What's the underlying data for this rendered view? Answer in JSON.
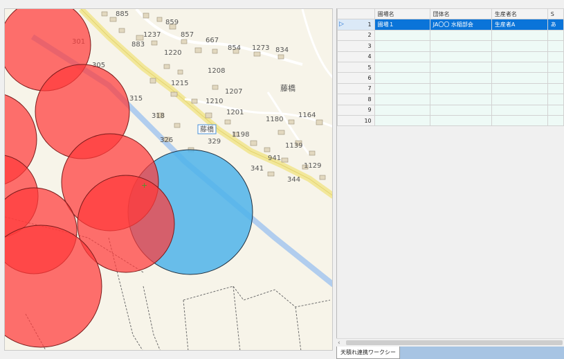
{
  "map": {
    "labels": {
      "n885": "885",
      "n859": "859",
      "n1237": "1237",
      "n857": "857",
      "n301": "301",
      "n883": "883",
      "n667": "667",
      "n854": "854",
      "n1273": "1273",
      "n834": "834",
      "n1220": "1220",
      "n305": "305",
      "n1208": "1208",
      "n1215": "1215",
      "n1207": "1207",
      "n315": "315",
      "n1210": "1210",
      "n1201": "1201",
      "n318": "318",
      "n1180": "1180",
      "n1164": "1164",
      "n1198": "1198",
      "n326": "326",
      "n329": "329",
      "n1139": "1139",
      "n941": "941",
      "n341": "341",
      "n1129": "1129",
      "n344": "344"
    },
    "place_name": "藤橋",
    "station_label": "藤橋",
    "colors": {
      "red_circle": "#ff3a3a",
      "blue_circle": "#4fb3ea",
      "road": "#f2e79a",
      "rail": "#a9c9ee",
      "background": "#f7f4e9"
    }
  },
  "grid": {
    "columns": [
      "",
      "圃場名",
      "団体名",
      "生産者名",
      "S"
    ],
    "rows": [
      {
        "num": "1",
        "field": "圃場１",
        "group": "JA〇〇 水稲部会",
        "producer": "生産者A",
        "extra": "あ"
      },
      {
        "num": "2",
        "field": "",
        "group": "",
        "producer": "",
        "extra": ""
      },
      {
        "num": "3",
        "field": "",
        "group": "",
        "producer": "",
        "extra": ""
      },
      {
        "num": "4",
        "field": "",
        "group": "",
        "producer": "",
        "extra": ""
      },
      {
        "num": "5",
        "field": "",
        "group": "",
        "producer": "",
        "extra": ""
      },
      {
        "num": "6",
        "field": "",
        "group": "",
        "producer": "",
        "extra": ""
      },
      {
        "num": "7",
        "field": "",
        "group": "",
        "producer": "",
        "extra": ""
      },
      {
        "num": "8",
        "field": "",
        "group": "",
        "producer": "",
        "extra": ""
      },
      {
        "num": "9",
        "field": "",
        "group": "",
        "producer": "",
        "extra": ""
      },
      {
        "num": "10",
        "field": "",
        "group": "",
        "producer": "",
        "extra": ""
      }
    ],
    "selected_row_marker": "▷"
  },
  "scrollbar": {
    "left_arrow": "‹"
  },
  "tabs": {
    "active": "天積れ連携ワークシート"
  }
}
